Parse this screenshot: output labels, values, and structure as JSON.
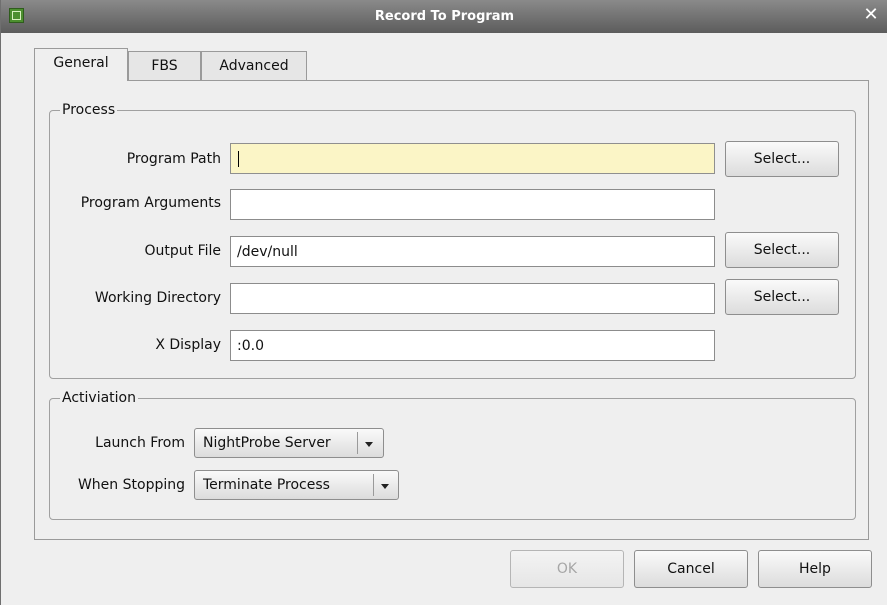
{
  "window": {
    "title": "Record To Program"
  },
  "tabs": [
    {
      "label": "General",
      "active": true
    },
    {
      "label": "FBS",
      "active": false
    },
    {
      "label": "Advanced",
      "active": false
    }
  ],
  "process": {
    "legend": "Process",
    "program_path": {
      "label": "Program Path",
      "value": ""
    },
    "program_arguments": {
      "label": "Program Arguments",
      "value": ""
    },
    "output_file": {
      "label": "Output File",
      "value": "/dev/null"
    },
    "working_directory": {
      "label": "Working Directory",
      "value": ""
    },
    "x_display": {
      "label": "X Display",
      "value": ":0.0"
    },
    "select_label": "Select..."
  },
  "activation": {
    "legend": "Activiation",
    "launch_from": {
      "label": "Launch From",
      "value": "NightProbe Server"
    },
    "when_stopping": {
      "label": "When Stopping",
      "value": "Terminate Process"
    }
  },
  "buttons": {
    "ok": "OK",
    "cancel": "Cancel",
    "help": "Help"
  },
  "colors": {
    "focused_field": "#fbf5c6",
    "titlebar": "#6f6f6f"
  }
}
